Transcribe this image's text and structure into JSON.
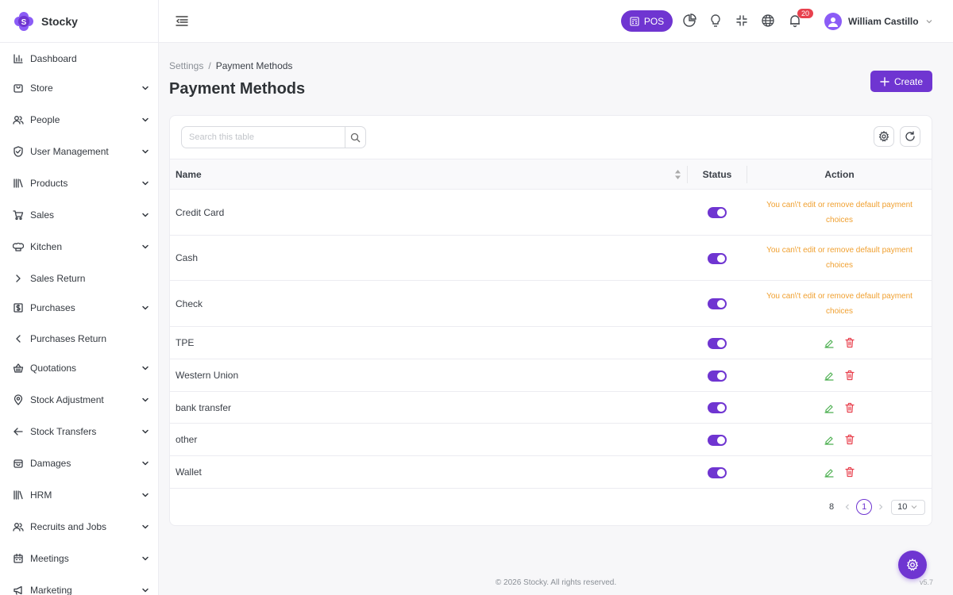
{
  "app": {
    "name": "Stocky",
    "version": "v5.7"
  },
  "sidebar": {
    "items": [
      {
        "label": "Dashboard",
        "icon": "chart-bar-icon",
        "chevron": "none"
      },
      {
        "label": "Store",
        "icon": "store-icon",
        "chevron": "down"
      },
      {
        "label": "People",
        "icon": "users-icon",
        "chevron": "down"
      },
      {
        "label": "User Management",
        "icon": "shield-check-icon",
        "chevron": "down"
      },
      {
        "label": "Products",
        "icon": "books-icon",
        "chevron": "down"
      },
      {
        "label": "Sales",
        "icon": "cart-icon",
        "chevron": "down"
      },
      {
        "label": "Kitchen",
        "icon": "chef-hat-icon",
        "chevron": "down"
      },
      {
        "label": "Sales Return",
        "icon": "chevron-right-icon",
        "chevron": "none"
      },
      {
        "label": "Purchases",
        "icon": "receipt-icon",
        "chevron": "down"
      },
      {
        "label": "Purchases Return",
        "icon": "chevron-left-icon",
        "chevron": "none"
      },
      {
        "label": "Quotations",
        "icon": "basket-icon",
        "chevron": "down"
      },
      {
        "label": "Stock Adjustment",
        "icon": "location-pin-icon",
        "chevron": "down"
      },
      {
        "label": "Stock Transfers",
        "icon": "arrow-left-icon",
        "chevron": "down"
      },
      {
        "label": "Damages",
        "icon": "box-icon",
        "chevron": "down"
      },
      {
        "label": "HRM",
        "icon": "library-icon",
        "chevron": "down"
      },
      {
        "label": "Recruits and Jobs",
        "icon": "users-icon",
        "chevron": "down"
      },
      {
        "label": "Meetings",
        "icon": "calendar-icon",
        "chevron": "down"
      },
      {
        "label": "Marketing",
        "icon": "megaphone-icon",
        "chevron": "down"
      }
    ]
  },
  "header": {
    "pos_label": "POS",
    "notification_count": "20",
    "user_name": "William Castillo"
  },
  "breadcrumb": {
    "parent": "Settings",
    "separator": "/",
    "current": "Payment Methods"
  },
  "page_title": "Payment Methods",
  "create_label": "Create",
  "search": {
    "placeholder": "Search this table"
  },
  "table": {
    "columns": {
      "name": "Name",
      "status": "Status",
      "action": "Action"
    },
    "default_note": "You can\\'t edit or remove default payment choices",
    "rows": [
      {
        "name": "Credit Card",
        "status": true,
        "is_default": true
      },
      {
        "name": "Cash",
        "status": true,
        "is_default": true
      },
      {
        "name": "Check",
        "status": true,
        "is_default": true
      },
      {
        "name": "TPE",
        "status": true,
        "is_default": false
      },
      {
        "name": "Western Union",
        "status": true,
        "is_default": false
      },
      {
        "name": "bank transfer",
        "status": true,
        "is_default": false
      },
      {
        "name": "other",
        "status": true,
        "is_default": false
      },
      {
        "name": "Wallet",
        "status": true,
        "is_default": false
      }
    ]
  },
  "pagination": {
    "total": "8",
    "current_page": "1",
    "page_size": "10"
  },
  "footer": "© 2026 Stocky. All rights reserved.",
  "colors": {
    "primary": "#6f35d1",
    "warning": "#f0a030",
    "success": "#4caf50",
    "danger": "#e8414e"
  }
}
